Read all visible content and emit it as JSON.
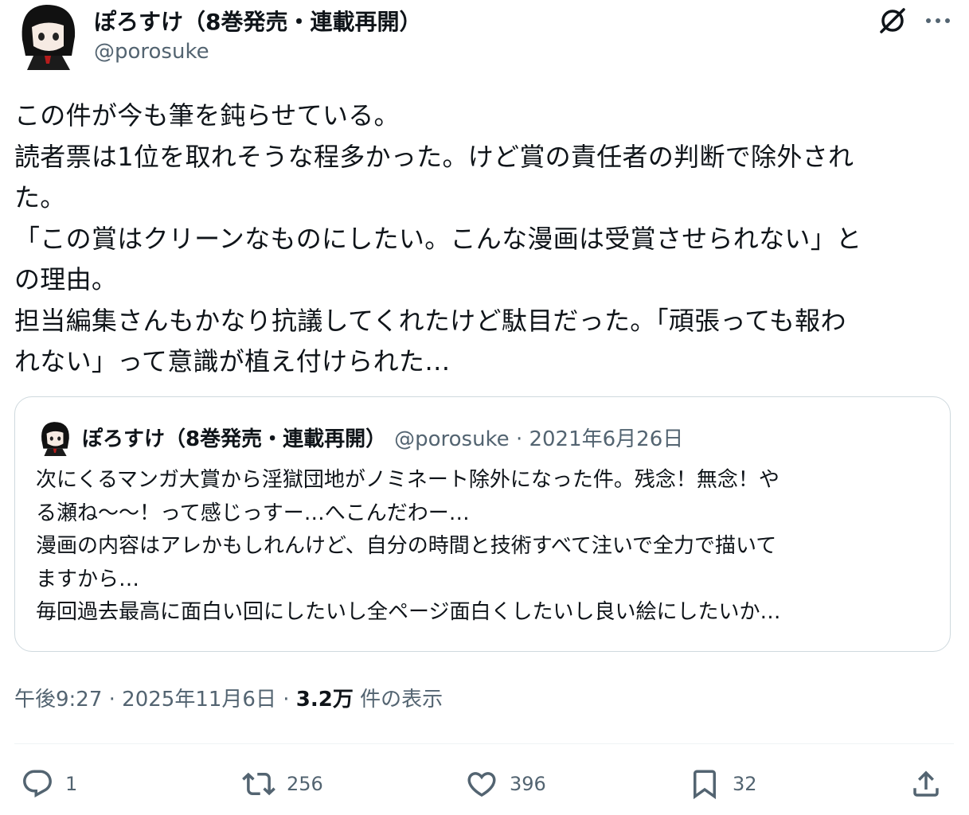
{
  "author": {
    "display_name": "ぽろすけ（8巻発売・連載再開）",
    "handle": "@porosuke"
  },
  "header": {
    "grok_icon": "grok-icon",
    "more_icon": "more-icon"
  },
  "tweet": {
    "text": "この件が今も筆を鈍らせている。\n読者票は1位を取れそうな程多かった。けど賞の責任者の判断で除外され\nた。\n「この賞はクリーンなものにしたい。こんな漫画は受賞させられない」と\nの理由。\n担当編集さんもかなり抗議してくれたけど駄目だった。「頑張っても報わ\nれない」って意識が植え付けられた…"
  },
  "quote": {
    "display_name": "ぽろすけ（8巻発売・連載再開）",
    "meta": "@porosuke · 2021年6月26日",
    "text": "次にくるマンガ大賞から淫獄団地がノミネート除外になった件。残念！無念！や\nる瀬ね〜〜！って感じっすー…へこんだわー…\n漫画の内容はアレかもしれんけど、自分の時間と技術すべて注いで全力で描いて\nますから…\n毎回過去最高に面白い回にしたいし全ページ面白くしたいし良い絵にしたいか…"
  },
  "meta": {
    "time_date": "午後9:27 · 2025年11月6日 · ",
    "views_count": "3.2万",
    "views_label": " 件の表示"
  },
  "actions": {
    "reply_count": "1",
    "retweet_count": "256",
    "like_count": "396",
    "bookmark_count": "32"
  },
  "colors": {
    "text": "#0f1419",
    "secondary": "#536471",
    "border": "#cfd9de"
  }
}
